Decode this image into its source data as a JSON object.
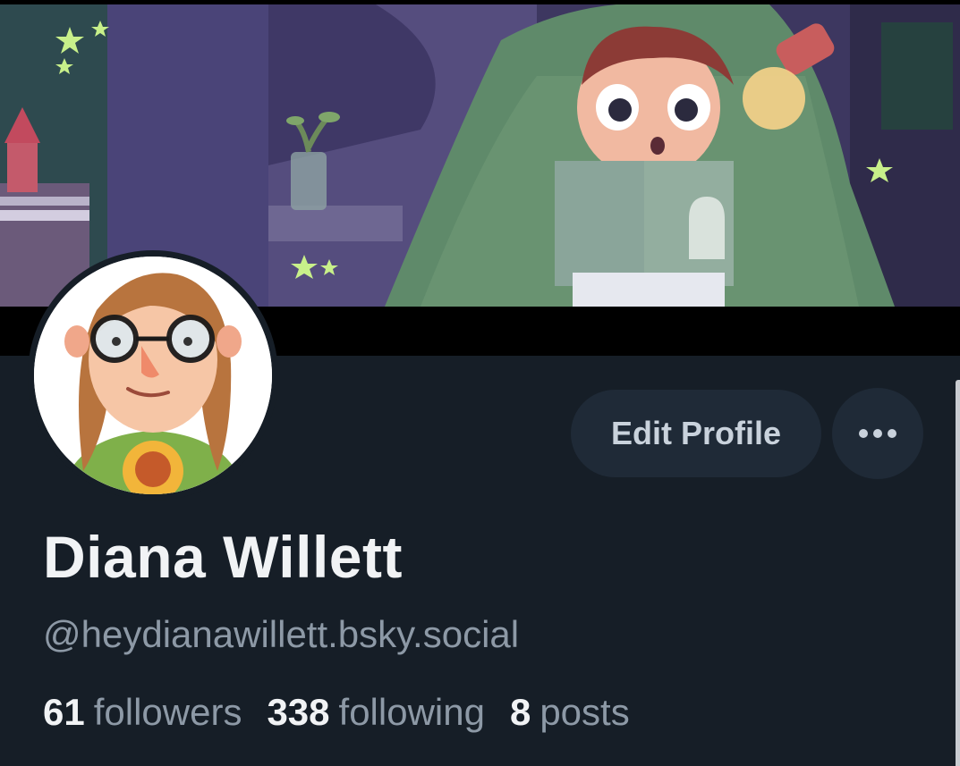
{
  "profile": {
    "display_name": "Diana Willett",
    "handle": "@heydianawillett.bsky.social",
    "stats": {
      "followers_count": "61",
      "followers_label": "followers",
      "following_count": "338",
      "following_label": "following",
      "posts_count": "8",
      "posts_label": "posts"
    }
  },
  "actions": {
    "edit_profile_label": "Edit Profile",
    "more_icon": "ellipsis-icon"
  },
  "colors": {
    "background": "#161e27",
    "button_bg": "#1f2a37",
    "text_primary": "#f1f3f5",
    "text_secondary": "#8d99a6"
  }
}
